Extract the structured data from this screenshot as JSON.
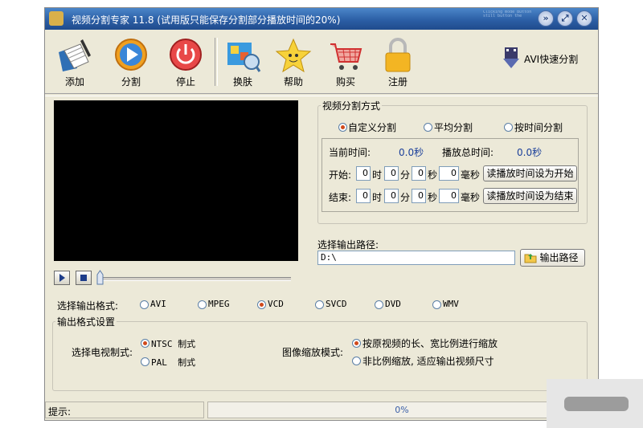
{
  "window": {
    "title": "视频分割专家 11.8 (试用版只能保存分割部分播放时间的20%)",
    "title_decoration": "Clicking mode Button still button the",
    "title_buttons": [
      "pin-icon",
      "restore-icon",
      "close-icon"
    ]
  },
  "toolbar": {
    "items": [
      {
        "label": "添加",
        "icon": "add-folder-icon"
      },
      {
        "label": "分割",
        "icon": "play-split-icon"
      },
      {
        "label": "停止",
        "icon": "stop-power-icon"
      },
      {
        "label": "换肤",
        "icon": "skin-palette-icon"
      },
      {
        "label": "帮助",
        "icon": "help-star-icon"
      },
      {
        "label": "购买",
        "icon": "cart-icon"
      },
      {
        "label": "注册",
        "icon": "lock-icon"
      }
    ],
    "avi_split_label": "AVI快速分割"
  },
  "split_mode": {
    "legend": "视频分割方式",
    "options": [
      "自定义分割",
      "平均分割",
      "按时间分割"
    ],
    "selected": "自定义分割",
    "current_time_label": "当前时间:",
    "current_time_value": "0.0秒",
    "total_time_label": "播放总时间:",
    "total_time_value": "0.0秒",
    "start_label": "开始:",
    "end_label": "结束:",
    "unit_hour": "时",
    "unit_minute": "分",
    "unit_second": "秒",
    "unit_ms": "毫秒",
    "start_values": {
      "h": "0",
      "m": "0",
      "s": "0",
      "ms": "0"
    },
    "end_values": {
      "h": "0",
      "m": "0",
      "s": "0",
      "ms": "0"
    },
    "set_start_button": "读播放时间设为开始",
    "set_end_button": "读播放时间设为结束"
  },
  "output_path": {
    "label": "选择输出路径:",
    "value": "D:\\",
    "button": "输出路径"
  },
  "output_format": {
    "label": "选择输出格式:",
    "options": [
      "AVI",
      "MPEG",
      "VCD",
      "SVCD",
      "DVD",
      "WMV"
    ],
    "selected": "VCD"
  },
  "format_settings": {
    "legend": "输出格式设置",
    "tv_standard_label": "选择电视制式:",
    "tv_options": [
      "NTSC 制式",
      "PAL  制式"
    ],
    "tv_selected": "NTSC 制式",
    "scale_label": "图像缩放模式:",
    "scale_options": [
      "按原视频的长、宽比例进行缩放",
      "非比例缩放, 适应输出视频尺寸"
    ],
    "scale_selected": "按原视频的长、宽比例进行缩放"
  },
  "status": {
    "hint_label": "提示:",
    "progress_text": "0%",
    "progress": 0
  },
  "colors": {
    "title_bar": "#2c5fa6",
    "window_bg": "#ece9d8",
    "radio_dot": "#d04a1c",
    "progress_text": "#3a5fa8"
  }
}
